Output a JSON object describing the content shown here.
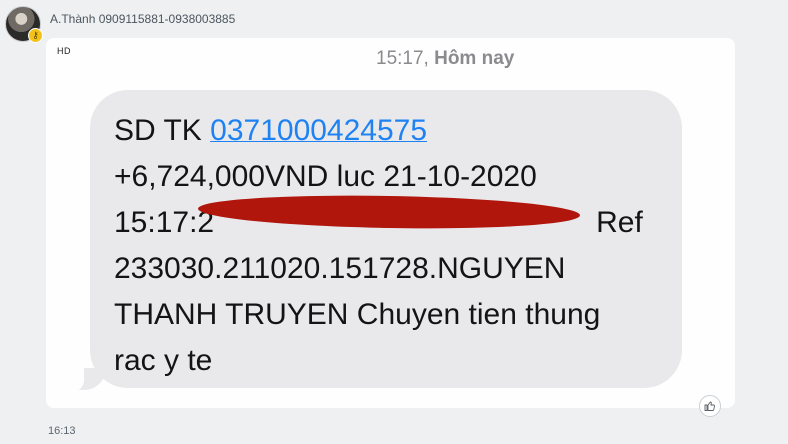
{
  "sender": {
    "name": "A.Thành 0909115881-0938003885"
  },
  "image": {
    "hd_label": "HD",
    "header_time": "15:17,",
    "header_day": "Hôm nay",
    "message": {
      "line1_prefix": "SD TK ",
      "account_link": "0371000424575",
      "line2": "+6,724,000VND luc 21-10-2020",
      "line3_start": "15:17:2",
      "line3_end": "Ref",
      "line4": "233030.211020.151728.NGUYEN",
      "line5": "THANH TRUYEN Chuyen tien thung",
      "line6": "rac y te"
    }
  },
  "message_time": "16:13",
  "colors": {
    "link": "#1f82f3",
    "redaction": "#b1160d",
    "bubble": "#e9e9eb"
  }
}
